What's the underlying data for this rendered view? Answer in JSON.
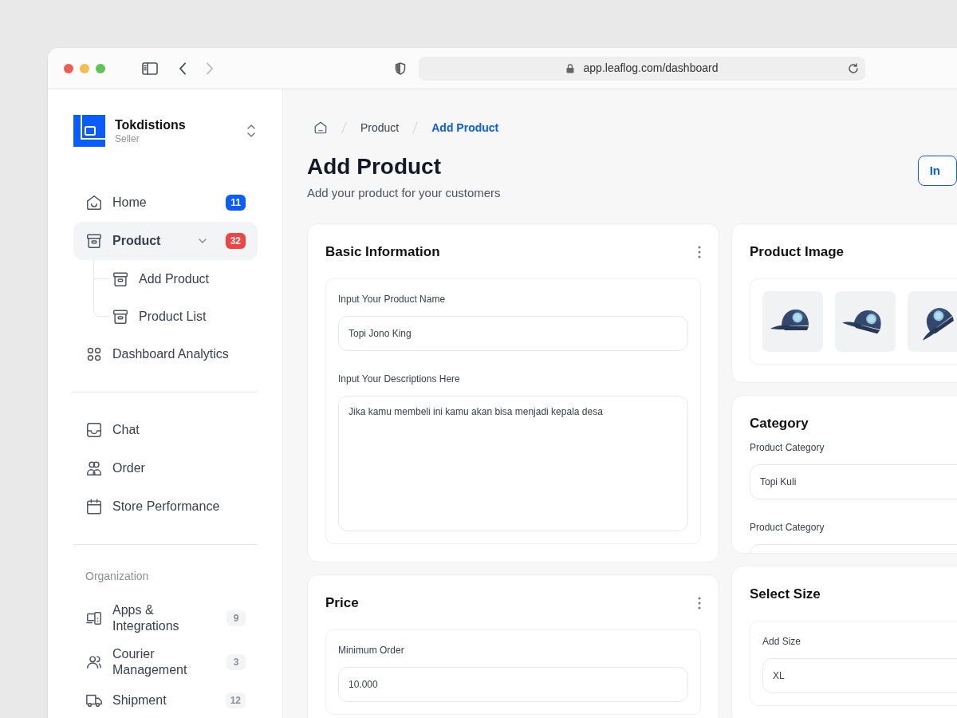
{
  "browser": {
    "url": "app.leaflog.com/dashboard",
    "back_enabled": true,
    "forward_enabled": false
  },
  "sidebar": {
    "brand": {
      "name": "Tokdistions",
      "role": "Seller"
    },
    "groups": [
      {
        "items": [
          {
            "label": "Home",
            "selected": false,
            "badge": {
              "text": "11",
              "color": "#0b5cff"
            }
          },
          {
            "label": "Product",
            "selected": true,
            "expanded": true,
            "badge": {
              "text": "32",
              "color": "#ef4444"
            },
            "children": [
              {
                "label": "Add Product",
                "selected": false
              },
              {
                "label": "Product List",
                "selected": false
              }
            ]
          },
          {
            "label": "Dashboard Analytics",
            "selected": false
          }
        ]
      },
      {
        "items": [
          {
            "label": "Chat",
            "selected": false
          },
          {
            "label": "Order",
            "selected": false
          },
          {
            "label": "Store Performance",
            "selected": false
          }
        ]
      },
      {
        "heading": "Organization",
        "items": [
          {
            "label": "Apps & Integrations",
            "selected": false,
            "badge": {
              "text": "9",
              "color": "#f3f4f6"
            }
          },
          {
            "label": "Courier Management",
            "selected": false,
            "badge": {
              "text": "3",
              "color": "#f3f4f6"
            }
          },
          {
            "label": "Shipment",
            "selected": false,
            "badge": {
              "text": "12",
              "color": "#f3f4f6"
            }
          }
        ]
      }
    ]
  },
  "breadcrumb": [
    {
      "label": "Product",
      "current": false
    },
    {
      "label": "Add Product",
      "current": true
    }
  ],
  "page": {
    "title": "Add Product",
    "subtitle": "Add your product for your customers",
    "header_button": "In"
  },
  "columns": [
    [
      {
        "kind": "boxed_fields",
        "title": "Basic Information",
        "menu": true,
        "fields": [
          {
            "label": "Input Your Product Name",
            "value": "Topi Jono King",
            "multiline": false
          },
          {
            "label": "Input Your Descriptions Here",
            "value": "Jika kamu membeli ini kamu akan bisa menjadi kepala desa",
            "multiline": true
          }
        ]
      },
      {
        "kind": "boxed_fields",
        "title": "Price",
        "menu": true,
        "fields": [
          {
            "label": "Minimum Order",
            "value": "10.000",
            "multiline": false
          }
        ]
      }
    ],
    [
      {
        "kind": "images",
        "title": "Product Image"
      },
      {
        "kind": "fields",
        "title": "Category",
        "fields": [
          {
            "label": "Product Category",
            "value": "Topi Kuli",
            "multiline": false
          },
          {
            "label": "Product Category",
            "multiline": false
          }
        ]
      },
      {
        "kind": "boxed_fields",
        "title": "Select Size",
        "fields": [
          {
            "label": "Add Size",
            "value": "XL",
            "multiline": false
          }
        ]
      }
    ]
  ]
}
